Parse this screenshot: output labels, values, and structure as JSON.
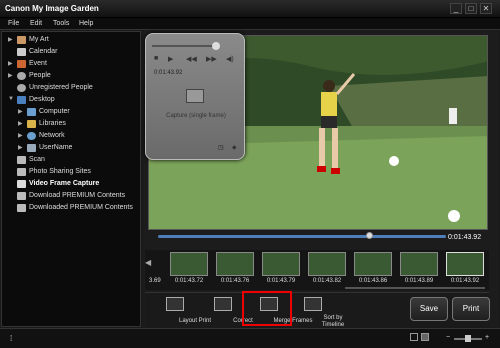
{
  "window": {
    "title": "Canon My Image Garden",
    "minimize": "_",
    "restore": "□",
    "close": "✕"
  },
  "menu": [
    "File",
    "Edit",
    "Tools",
    "Help"
  ],
  "sidebar": {
    "items": [
      {
        "label": "My Art",
        "expander": "▶",
        "icon_color": "#c96"
      },
      {
        "label": "Calendar",
        "expander": "",
        "icon_color": "#ccc"
      },
      {
        "label": "Event",
        "expander": "▶",
        "icon_color": "#c63"
      },
      {
        "label": "People",
        "expander": "▶",
        "icon_color": "#aaa"
      },
      {
        "label": "Unregistered People",
        "expander": "",
        "icon_color": "#aaa"
      },
      {
        "label": "Desktop",
        "expander": "▼",
        "icon_color": "#4a7fc0"
      },
      {
        "label": "Computer",
        "expander": "▶",
        "icon_color": "#6a9fd0"
      },
      {
        "label": "Libraries",
        "expander": "▶",
        "icon_color": "#d9b24a"
      },
      {
        "label": "Network",
        "expander": "▶",
        "icon_color": "#6a9fd0"
      },
      {
        "label": "UserName",
        "expander": "▶",
        "icon_color": "#9ab"
      },
      {
        "label": "Scan",
        "expander": "",
        "icon_color": "#bbb"
      },
      {
        "label": "Photo Sharing Sites",
        "expander": "",
        "icon_color": "#bbb"
      },
      {
        "label": "Video Frame Capture",
        "expander": "",
        "icon_color": "#ddd"
      },
      {
        "label": "Download PREMIUM Contents",
        "expander": "",
        "icon_color": "#bbb"
      },
      {
        "label": "Downloaded PREMIUM Contents",
        "expander": "",
        "icon_color": "#bbb"
      }
    ]
  },
  "capture_panel": {
    "time": "0:01:43.92",
    "capture_label": "Capture (single frame)"
  },
  "player": {
    "time": "0:01:43.92",
    "progress": 0.73
  },
  "filmstrip": {
    "left_partial_time": "3.69",
    "times": [
      "0:01:43.72",
      "0:01:43.76",
      "0:01:43.79",
      "0:01:43.82",
      "0:01:43.86",
      "0:01:43.89",
      "0:01:43.92"
    ]
  },
  "toolbar": {
    "layout_print": "Layout Print",
    "correct": "Correct",
    "merge_frames": "Merge Frames",
    "sort_by_timeline_1": "Sort by",
    "sort_by_timeline_2": "Timeline",
    "save": "Save",
    "print": "Print"
  },
  "colors": {
    "highlight": "#e00000",
    "accent": "#4f7fb8"
  }
}
